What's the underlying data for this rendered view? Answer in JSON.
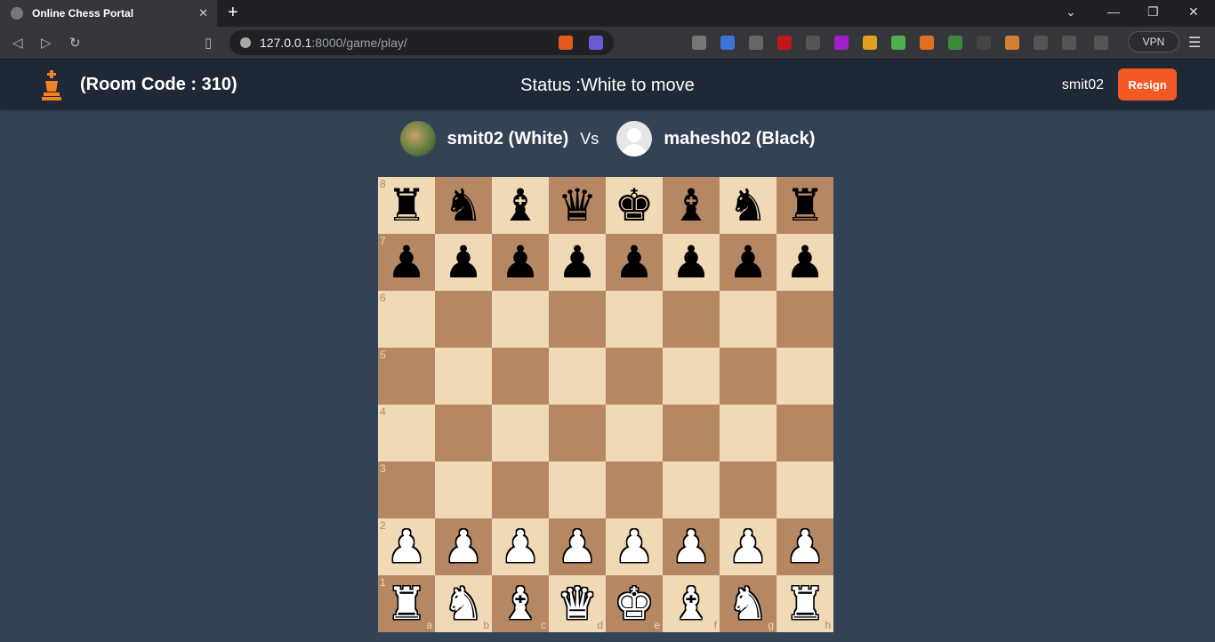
{
  "browser": {
    "tab_title": "Online Chess Portal",
    "url_host": "127.0.0.1",
    "url_path": ":8000/game/play/",
    "vpn_label": "VPN"
  },
  "header": {
    "room_label": "(Room Code : 310)",
    "status": "Status :White to move",
    "username": "smit02",
    "resign_label": "Resign"
  },
  "players": {
    "white": "smit02 (White)",
    "vs": "Vs",
    "black": "mahesh02 (Black)"
  },
  "board": {
    "files": [
      "a",
      "b",
      "c",
      "d",
      "e",
      "f",
      "g",
      "h"
    ],
    "ranks": [
      "8",
      "7",
      "6",
      "5",
      "4",
      "3",
      "2",
      "1"
    ],
    "position": [
      [
        "bR",
        "bN",
        "bB",
        "bQ",
        "bK",
        "bB",
        "bN",
        "bR"
      ],
      [
        "bP",
        "bP",
        "bP",
        "bP",
        "bP",
        "bP",
        "bP",
        "bP"
      ],
      [
        "",
        "",
        "",
        "",
        "",
        "",
        "",
        ""
      ],
      [
        "",
        "",
        "",
        "",
        "",
        "",
        "",
        ""
      ],
      [
        "",
        "",
        "",
        "",
        "",
        "",
        "",
        ""
      ],
      [
        "",
        "",
        "",
        "",
        "",
        "",
        "",
        ""
      ],
      [
        "wP",
        "wP",
        "wP",
        "wP",
        "wP",
        "wP",
        "wP",
        "wP"
      ],
      [
        "wR",
        "wN",
        "wB",
        "wQ",
        "wK",
        "wB",
        "wN",
        "wR"
      ]
    ]
  },
  "colors": {
    "light_square": "#f0d9b5",
    "dark_square": "#b58863",
    "accent": "#f15a24",
    "background": "#344256"
  }
}
